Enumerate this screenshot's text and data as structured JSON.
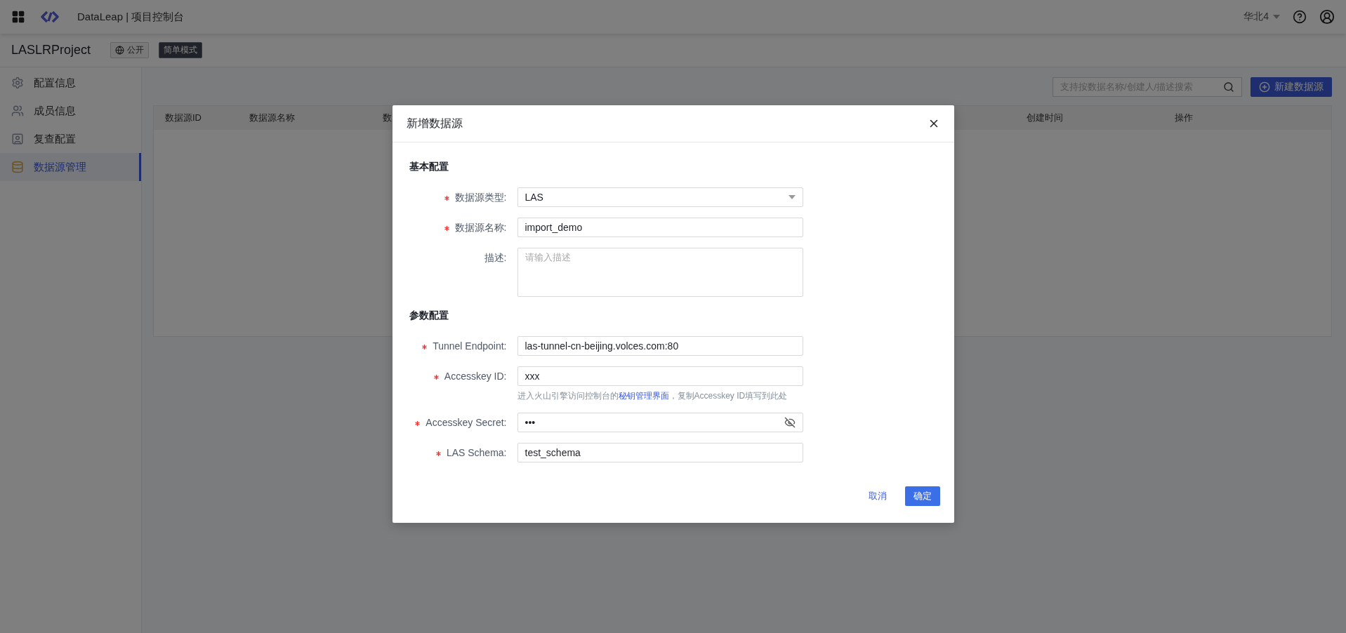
{
  "topbar": {
    "title": "DataLeap | 项目控制台",
    "region": "华北4"
  },
  "project": {
    "name": "LASLRProject",
    "tags": [
      {
        "kind": "visibility",
        "label": "公开"
      },
      {
        "kind": "mode",
        "label": "简单模式"
      }
    ]
  },
  "sidebar": {
    "items": [
      {
        "kind": "config",
        "label": "配置信息",
        "selected": false
      },
      {
        "kind": "members",
        "label": "成员信息",
        "selected": false
      },
      {
        "kind": "review",
        "label": "复查配置",
        "selected": false
      },
      {
        "kind": "datasource",
        "label": "数据源管理",
        "selected": true
      }
    ]
  },
  "toolbar": {
    "search": {
      "placeholder": "支持按数据名称/创建人/描述搜索"
    },
    "new_button": "新建数据源"
  },
  "table": {
    "columns": [
      "数据源ID",
      "数据源名称",
      "数",
      "创建时间",
      "操作"
    ]
  },
  "dialog": {
    "title": "新增数据源",
    "sections": [
      {
        "title": "基本配置",
        "fields": [
          {
            "kind": "select",
            "required": true,
            "label": "数据源类型:",
            "value": "LAS"
          },
          {
            "kind": "input",
            "required": true,
            "label": "数据源名称:",
            "value": "import_demo"
          },
          {
            "kind": "textarea",
            "required": false,
            "label": "描述:",
            "placeholder": "请输入描述"
          }
        ]
      },
      {
        "title": "参数配置",
        "fields": [
          {
            "kind": "input",
            "required": true,
            "label": "Tunnel Endpoint:",
            "value": "las-tunnel-cn-beijing.volces.com:80"
          },
          {
            "kind": "input",
            "required": true,
            "label": "Accesskey ID:",
            "value": "xxx",
            "hint": {
              "before": "进入火山引擎访问控制台的",
              "link": "秘钥管理界面",
              "after": "，复制Accesskey ID填写到此处"
            }
          },
          {
            "kind": "password",
            "required": true,
            "label": "Accesskey Secret:",
            "value": "•••"
          },
          {
            "kind": "input",
            "required": true,
            "label": "LAS Schema:",
            "value": "test_schema"
          }
        ]
      }
    ],
    "cancel": "取消",
    "confirm": "确定"
  }
}
